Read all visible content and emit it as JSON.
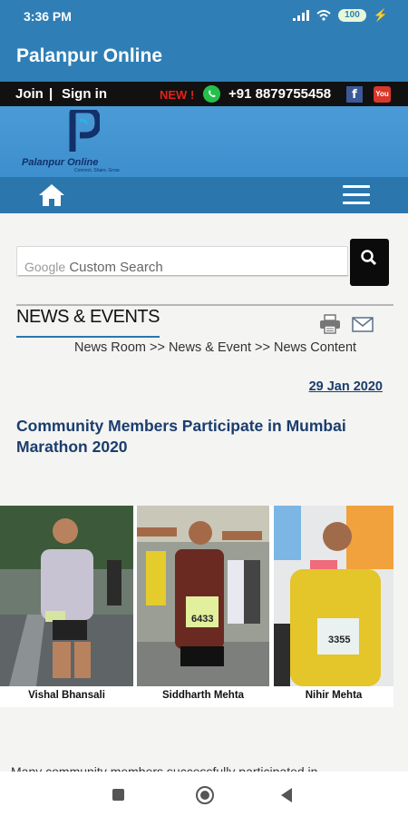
{
  "status_bar": {
    "time": "3:36 PM",
    "battery": "100"
  },
  "app_bar": {
    "title": "Palanpur Online"
  },
  "top_strip": {
    "join": "Join",
    "separator": "|",
    "sign_in": "Sign in",
    "new_badge": "NEW !",
    "phone": "+91 8879755458",
    "facebook_letter": "f",
    "youtube_label": "You"
  },
  "logo": {
    "brand": "Palanpur Online",
    "tagline": "Connect. Share. Grow."
  },
  "search": {
    "google_label": "Google",
    "placeholder": "Custom Search"
  },
  "section": {
    "heading": "NEWS & EVENTS"
  },
  "breadcrumb": {
    "text": "News Room >> News & Event >> News Content"
  },
  "article": {
    "date": "29 Jan 2020",
    "title": "Community Members Participate in Mumbai Marathon 2020",
    "paragraph": "Many community members successfully participated in"
  },
  "photos": [
    {
      "caption": "Vishal Bhansali",
      "bib": "3867"
    },
    {
      "caption": "Siddharth Mehta",
      "bib": "6433"
    },
    {
      "caption": "Nihir Mehta",
      "bib": "3355"
    }
  ],
  "colors": {
    "brand_blue": "#2f7fb6",
    "title_navy": "#1a3d6e",
    "new_red": "#e2231a"
  }
}
